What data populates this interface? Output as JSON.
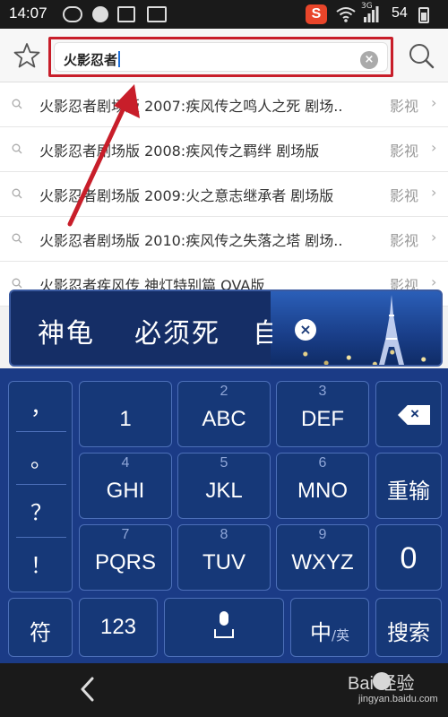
{
  "status_bar": {
    "time": "14:07",
    "battery": "54",
    "network": "3G",
    "icons": [
      "ring-icon",
      "sync-icon",
      "picture-icon",
      "keyboard-icon",
      "sogou-icon",
      "wifi-icon",
      "signal-icon",
      "battery-icon"
    ],
    "sogou_label": "S"
  },
  "search": {
    "query": "火影忍者",
    "clear_icon": "×",
    "icons": [
      "star-icon",
      "clear-icon",
      "search-icon"
    ],
    "highlight_color": "#c81e2a"
  },
  "suggestions": [
    {
      "text": "火影忍者剧场版 2007:疾风传之鸣人之死 剧场..",
      "category": "影视",
      "arrow": "›"
    },
    {
      "text": "火影忍者剧场版 2008:疾风传之羁绊 剧场版",
      "category": "影视",
      "arrow": "›"
    },
    {
      "text": "火影忍者剧场版 2009:火之意志继承者 剧场版",
      "category": "影视",
      "arrow": "›"
    },
    {
      "text": "火影忍者剧场版 2010:疾风传之失落之塔 剧场..",
      "category": "影视",
      "arrow": "›"
    },
    {
      "text": "火影忍者疾风传 神灯特别篇 OVA版",
      "category": "影视",
      "arrow": "›"
    }
  ],
  "candidates": {
    "words": [
      "神龟",
      "必须死",
      "自"
    ],
    "close": "×"
  },
  "keyboard": {
    "punctuation": [
      "，",
      "。",
      "？",
      "！"
    ],
    "row1": [
      {
        "digit": "",
        "letters": "1"
      },
      {
        "digit": "2",
        "letters": "ABC"
      },
      {
        "digit": "3",
        "letters": "DEF"
      }
    ],
    "row2": [
      {
        "digit": "4",
        "letters": "GHI"
      },
      {
        "digit": "5",
        "letters": "JKL"
      },
      {
        "digit": "6",
        "letters": "MNO"
      }
    ],
    "row3": [
      {
        "digit": "7",
        "letters": "PQRS"
      },
      {
        "digit": "8",
        "letters": "TUV"
      },
      {
        "digit": "9",
        "letters": "WXYZ"
      }
    ],
    "backspace_icon": "×",
    "reenter": "重输",
    "zero": "0",
    "symbols": "符",
    "numbers": "123",
    "lang_main": "中",
    "lang_sub": "/英",
    "search": "搜索",
    "key_color": "#163878"
  },
  "nav": {
    "back_icon": "chevron-left-icon"
  },
  "watermark": {
    "brand": "Bai  经验",
    "url": "jingyan.baidu.com"
  }
}
